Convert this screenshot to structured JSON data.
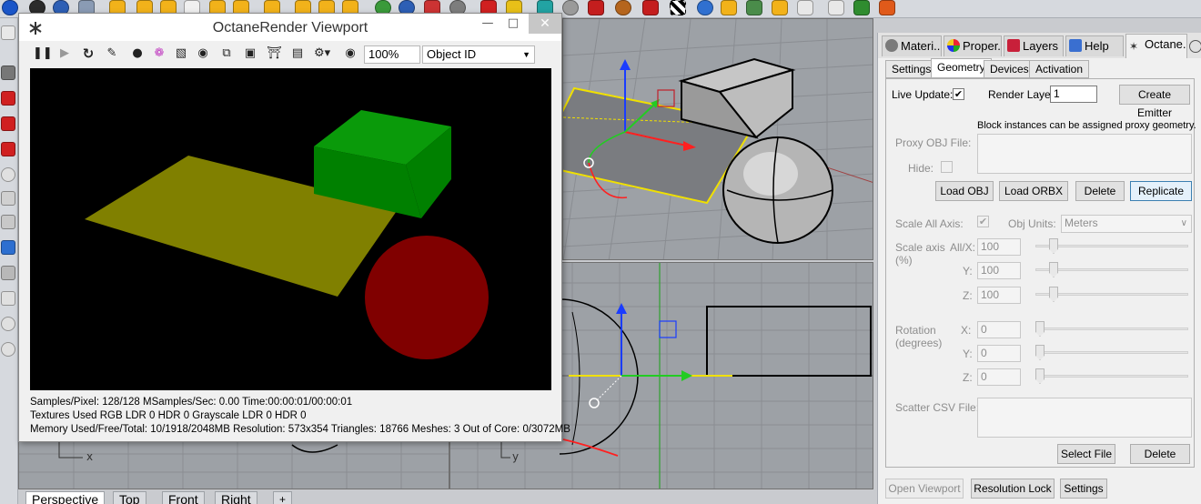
{
  "octane_window": {
    "title": "OctaneRender Viewport",
    "zoom": "100%",
    "render_mode": "Object ID",
    "status_lines": [
      "Samples/Pixel: 128/128  MSamples/Sec: 0.00  Time:00:00:01/00:00:01",
      "Textures Used RGB LDR 0  HDR 0  Grayscale LDR 0  HDR 0",
      "Memory Used/Free/Total: 10/1918/2048MB  Resolution: 573x354  Triangles: 18766  Meshes: 3 Out of Core: 0/3072MB"
    ],
    "scene_colors": {
      "plane": "#808000",
      "box": "#008000",
      "sphere": "#800000"
    }
  },
  "viewport_tabs": [
    "Perspective",
    "Top",
    "Front",
    "Right"
  ],
  "viewport_add_tab": "+",
  "axis_labels": {
    "top_x": "x",
    "front_y": "y"
  },
  "panel": {
    "tabs": [
      "Materi...",
      "Proper...",
      "Layers",
      "Help",
      "Octane..."
    ],
    "subtabs": [
      "Settings",
      "Geometry",
      "Devices",
      "Activation"
    ],
    "active_subtab": "Geometry",
    "geometry": {
      "live_update_label": "Live Update:",
      "live_update_checked": true,
      "render_layer_label": "Render Layer:",
      "render_layer_value": "1",
      "create_emitter": "Create Emitter",
      "info_text": "Block instances can be assigned proxy geometry.",
      "proxy_obj_label": "Proxy OBJ File:",
      "hide_label": "Hide:",
      "load_obj": "Load OBJ",
      "load_orbx": "Load ORBX",
      "delete": "Delete",
      "replicate": "Replicate",
      "scale_all_label": "Scale All Axis:",
      "obj_units_label": "Obj Units:",
      "obj_units_value": "Meters",
      "scale_axis_label": "Scale axis",
      "scale_axis_unit": "(%)",
      "allx_label": "All/X:",
      "y_label": "Y:",
      "z_label": "Z:",
      "scale_values": {
        "x": "100",
        "y": "100",
        "z": "100"
      },
      "rotation_label": "Rotation",
      "rotation_unit": "(degrees)",
      "x_label": "X:",
      "rotation_values": {
        "x": "0",
        "y": "0",
        "z": "0"
      },
      "scatter_label": "Scatter CSV File:",
      "select_file": "Select File",
      "delete2": "Delete"
    },
    "bottom_buttons": {
      "open_viewport": "Open Viewport",
      "resolution_lock": "Resolution Lock",
      "settings": "Settings"
    }
  }
}
